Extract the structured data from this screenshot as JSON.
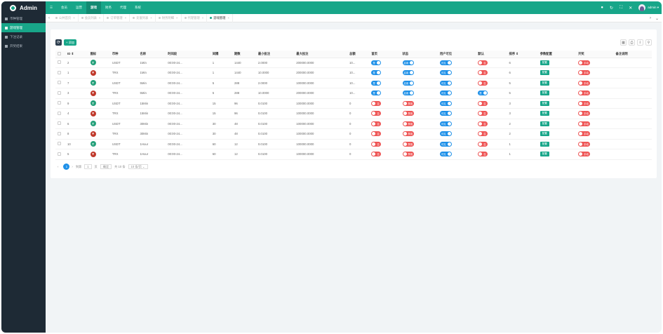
{
  "app": {
    "brand": "Admin"
  },
  "topnav": {
    "items": [
      "☰",
      "会员",
      "运营",
      "游戏",
      "财务",
      "代理",
      "系统"
    ],
    "active_index": 3
  },
  "topright": {
    "icons": [
      "●",
      "↻",
      "⛶",
      "✕"
    ],
    "user": "admin ▾"
  },
  "sidebar": {
    "items": [
      "币种管理",
      "游戏管理",
      "下注记录",
      "开奖结果"
    ],
    "active_index": 1
  },
  "tabs": {
    "left_arrow": "‹",
    "items": [
      "公共首页",
      "会员列表",
      "订单管理",
      "充值列表",
      "财务明细",
      "代理管理",
      "游戏管理"
    ],
    "active_index": 6,
    "close": "×",
    "right_arrows": [
      "›",
      "⌄"
    ]
  },
  "toolbar": {
    "refresh_icon": "⟳",
    "add_label": "+ 添加",
    "right_tools": [
      "▦",
      "⎙",
      "⇩",
      "⚲"
    ]
  },
  "table": {
    "headers": [
      "",
      "ID ⇕",
      "图标",
      "币种",
      "名称",
      "时间段",
      "间隔",
      "期数",
      "最小投注",
      "最大投注",
      "总额",
      "首页",
      "状态",
      "用户可见",
      "默认",
      "排序 ⇕",
      "参数配置",
      "开奖",
      "备注说明"
    ],
    "rows": [
      {
        "id": "2",
        "coin": "USDT",
        "name": "1Min",
        "time": "00:00-24...",
        "interval": "1",
        "periods": "1440",
        "min": "2.0000",
        "max": "200000.0000",
        "total": "10...",
        "home": "是",
        "status": "启用",
        "visible": "可见",
        "default": "否",
        "sort": "6",
        "config": "配置",
        "draw": "手动",
        "note": ""
      },
      {
        "id": "1",
        "coin": "TRX",
        "name": "1Min",
        "time": "00:00-24...",
        "interval": "1",
        "periods": "1440",
        "min": "10.0000",
        "max": "200000.0000",
        "total": "10...",
        "home": "是",
        "status": "启用",
        "visible": "可见",
        "default": "否",
        "sort": "6",
        "config": "配置",
        "draw": "手动",
        "note": ""
      },
      {
        "id": "7",
        "coin": "USDT",
        "name": "5Min",
        "time": "00:00-24...",
        "interval": "5",
        "periods": "288",
        "min": "2.0000",
        "max": "100000.0000",
        "total": "10...",
        "home": "是",
        "status": "启用",
        "visible": "可见",
        "default": "否",
        "sort": "5",
        "config": "配置",
        "draw": "手动",
        "note": ""
      },
      {
        "id": "3",
        "coin": "TRX",
        "name": "5Min",
        "time": "00:00-24...",
        "interval": "5",
        "periods": "288",
        "min": "10.0000",
        "max": "200000.0000",
        "total": "10...",
        "home": "是",
        "status": "启用",
        "visible": "可见",
        "default": "是",
        "sort": "5",
        "config": "配置",
        "draw": "手动",
        "note": ""
      },
      {
        "id": "9",
        "coin": "USDT",
        "name": "15Min",
        "time": "00:00-24...",
        "interval": "15",
        "periods": "96",
        "min": "0.0100",
        "max": "100000.0000",
        "total": "0",
        "home": "否",
        "status": "禁用",
        "visible": "可见",
        "default": "否",
        "sort": "3",
        "config": "配置",
        "draw": "手动",
        "note": ""
      },
      {
        "id": "4",
        "coin": "TRX",
        "name": "15Min",
        "time": "00:00-24...",
        "interval": "15",
        "periods": "96",
        "min": "0.0100",
        "max": "100000.0000",
        "total": "0",
        "home": "否",
        "status": "禁用",
        "visible": "可见",
        "default": "否",
        "sort": "3",
        "config": "配置",
        "draw": "手动",
        "note": ""
      },
      {
        "id": "6",
        "coin": "USDT",
        "name": "30Min",
        "time": "00:00-24...",
        "interval": "30",
        "periods": "48",
        "min": "0.0100",
        "max": "100000.0000",
        "total": "0",
        "home": "否",
        "status": "禁用",
        "visible": "可见",
        "default": "否",
        "sort": "2",
        "config": "配置",
        "draw": "手动",
        "note": ""
      },
      {
        "id": "8",
        "coin": "TRX",
        "name": "30Min",
        "time": "00:00-24...",
        "interval": "30",
        "periods": "48",
        "min": "0.0100",
        "max": "100000.0000",
        "total": "0",
        "home": "否",
        "status": "禁用",
        "visible": "可见",
        "default": "否",
        "sort": "2",
        "config": "配置",
        "draw": "手动",
        "note": ""
      },
      {
        "id": "10",
        "coin": "USDT",
        "name": "1Hour",
        "time": "00:00-24...",
        "interval": "60",
        "periods": "12",
        "min": "0.0100",
        "max": "100000.0000",
        "total": "0",
        "home": "否",
        "status": "禁用",
        "visible": "可见",
        "default": "否",
        "sort": "1",
        "config": "配置",
        "draw": "手动",
        "note": ""
      },
      {
        "id": "5",
        "coin": "TRX",
        "name": "1Hour",
        "time": "00:00-24...",
        "interval": "60",
        "periods": "12",
        "min": "0.0100",
        "max": "100000.0000",
        "total": "0",
        "home": "否",
        "status": "禁用",
        "visible": "可见",
        "default": "否",
        "sort": "1",
        "config": "配置",
        "draw": "手动",
        "note": ""
      }
    ]
  },
  "pager": {
    "prev": "‹",
    "current": "1",
    "next": "›",
    "goto": "到第",
    "page_input": "1",
    "page_unit": "页",
    "confirm": "确定",
    "total": "共 10 条",
    "per_page": "10 条/页 ⌄"
  },
  "colors": {
    "primary": "#18a689",
    "sidebar": "#1e2a35",
    "switch_on": "#1e90e8",
    "switch_off": "#ee5555",
    "usdt": "#26a17b",
    "trx": "#c0392b"
  }
}
